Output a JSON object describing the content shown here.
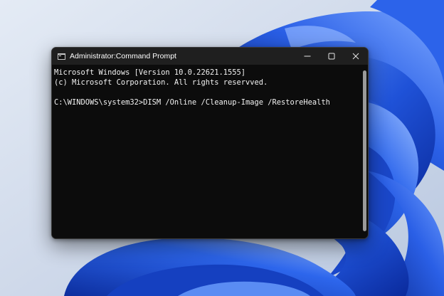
{
  "window": {
    "title": "Administrator:Command Prompt",
    "controls": {
      "minimize_icon": "minimize-icon",
      "maximize_icon": "maximize-icon",
      "close_icon": "close-icon"
    }
  },
  "console": {
    "lines": [
      "Microsoft Windows [Version 10.0.22621.1555]",
      "(c) Microsoft Corporation. All rights reservved.",
      "",
      "C:\\WINDOWS\\system32>DISM /Online /Cleanup-Image /RestoreHealth"
    ],
    "text_color": "#f2f2f2",
    "background_color": "#0c0c0c"
  },
  "colors": {
    "titlebar": "#1f1f1f",
    "wallpaper_blue": "#1e4fd6",
    "wallpaper_light": "#d6dfee"
  }
}
